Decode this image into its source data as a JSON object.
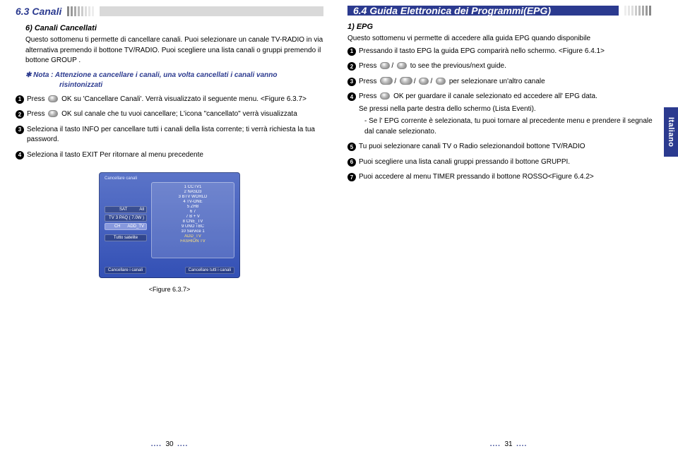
{
  "left": {
    "section_number": "6.3 Canali",
    "subhead": "6) Canali Cancellati",
    "p1": "Questo sottomenu ti permette di cancellare canali. Puoi selezionare un canale TV-RADIO in via alternativa premendo il bottone TV/RADIO. Puoi scegliere una lista canali o gruppi premendo il bottone GROUP .",
    "note_line1": "✱ Nota : Attenzione a cancellare i canali, una volta cancellati i canali vanno",
    "note_line2": "risintonizzati",
    "b1_a": "Press",
    "b1_b": "OK su 'Cancellare Canali'. Verrà visualizzato il seguente menu. <Figure 6.3.7>",
    "b2_a": "Press",
    "b2_b": "OK sul canale che tu vuoi cancellare; L'icona \"cancellato\" verrà visualizzata",
    "b3": "Seleziona il tasto INFO per cancellare tutti i canali della lista corrente; ti verrà richiesta la tua password.",
    "b4": "Seleziona il tasto EXIT Per ritornare al menu precedente",
    "figure_caption": "<Figure 6.3.7>",
    "ui": {
      "topbar": "Cancellare canali",
      "side": [
        "SAT",
        "TV",
        "CH",
        "Tutto"
      ],
      "side_vals": [
        "All",
        "3 PAQ ( 7.0W )",
        "ADD_TV",
        "Tutto satelite"
      ],
      "list": [
        "1  CCTV1",
        "2  NASD3",
        "3  BTV WORLD",
        "4  TV-ONE",
        "5  ZH8",
        "6  7",
        "7  B + V",
        "8  CNE_TV",
        "9  UNO TBC",
        "10  Service 1",
        "    ADD_TV",
        "    FASHION TV"
      ],
      "bottom_left": "Cancellare i canali",
      "bottom_right": "Cancellare tutti i canali"
    },
    "page_num": "30"
  },
  "right": {
    "section_title": "6.4 Guida Elettronica dei Programmi(EPG)",
    "subhead": "1) EPG",
    "p1": "Questo sottomenu vi permette di accedere alla guida EPG quando disponibile",
    "b1": "Pressando il tasto EPG la guida EPG comparirà nello schermo. <Figure 6.4.1>",
    "b2_a": "Press",
    "b2_b": "to see the previous/next guide.",
    "b3_a": "Press",
    "b3_b": "per selezionare un'altro canale",
    "b4_a": "Press",
    "b4_b": "OK per guardare il canale selezionato ed accedere all' EPG data.",
    "b4_c": "Se pressi nella parte destra dello schermo (Lista Eventi).",
    "b4_d": "- Se l' EPG corrente è selezionata, tu puoi tornare al precedente menu e prendere il segnale dal canale selezionato.",
    "b5": "Tu puoi selezionare canali TV o Radio selezionandoil bottone TV/RADIO",
    "b6": "Puoi scegliere una lista canali gruppi pressando il bottone GRUPPI.",
    "b7": "Puoi accedere al menu TIMER pressando il bottone ROSSO<Figure 6.4.2>",
    "side_tab": "Italiano",
    "page_num": "31"
  }
}
